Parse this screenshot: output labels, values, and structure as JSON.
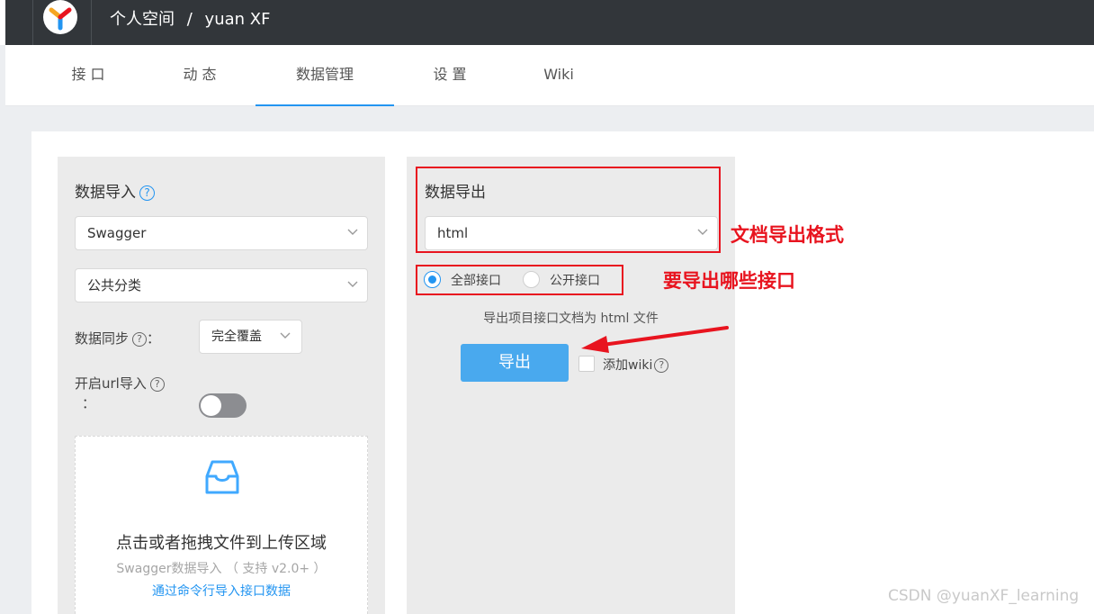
{
  "header": {
    "breadcrumb_space": "个人空间",
    "breadcrumb_sep": "/",
    "breadcrumb_user": "yuan XF"
  },
  "tabs": [
    {
      "label": "接 口"
    },
    {
      "label": "动 态"
    },
    {
      "label": "数据管理",
      "active": true
    },
    {
      "label": "设 置"
    },
    {
      "label": "Wiki"
    }
  ],
  "import": {
    "title": "数据导入",
    "help": "?",
    "format_value": "Swagger",
    "category_value": "公共分类",
    "sync_label": "数据同步",
    "sync_colon": "：",
    "sync_value": "完全覆盖",
    "url_label": "开启url导入",
    "url_colon": "：",
    "url_toggle_on": false,
    "dropzone_main": "点击或者拖拽文件到上传区域",
    "dropzone_sub": "Swagger数据导入 （ 支持 v2.0+ ）",
    "dropzone_link": "通过命令行导入接口数据"
  },
  "export": {
    "title": "数据导出",
    "format_value": "html",
    "radio_all": "全部接口",
    "radio_public": "公开接口",
    "selected_radio": "全部接口",
    "description": "导出项目接口文档为 html 文件",
    "button_label": "导出",
    "add_wiki_label": "添加wiki",
    "add_wiki_checked": false
  },
  "annotations": {
    "format_note": "文档导出格式",
    "scope_note": "要导出哪些接口"
  },
  "watermark": "CSDN @yuanXF_learning",
  "colors": {
    "header_bg": "#32363a",
    "accent": "#2395f1",
    "button": "#49a9ee",
    "annotation_red": "#e8141f"
  }
}
